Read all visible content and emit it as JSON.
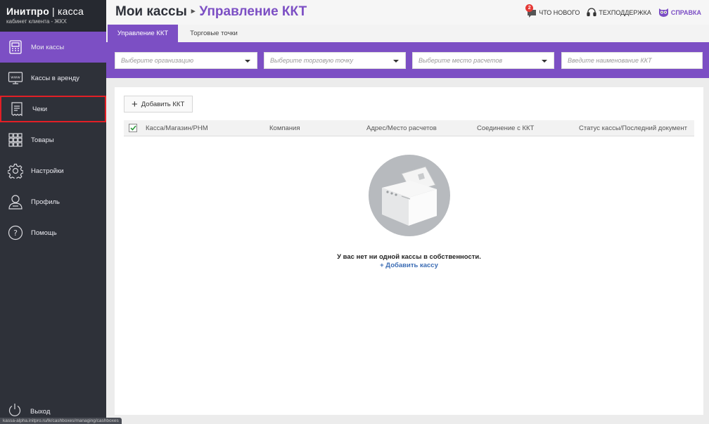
{
  "brand": {
    "title_bold": "Инитпро",
    "title_sep": "|",
    "title_light": "касса",
    "subtitle": "кабинет клиента - ЖКХ"
  },
  "sidebar": {
    "items": [
      {
        "label": "Мои кассы",
        "icon": "cash-register-icon"
      },
      {
        "label": "Кассы в аренду",
        "icon": "monitor-www-icon"
      },
      {
        "label": "Чеки",
        "icon": "receipt-icon"
      },
      {
        "label": "Товары",
        "icon": "grid-icon"
      },
      {
        "label": "Настройки",
        "icon": "gear-icon"
      },
      {
        "label": "Профиль",
        "icon": "user-icon"
      },
      {
        "label": "Помощь",
        "icon": "help-icon"
      }
    ],
    "logout": "Выход"
  },
  "status_url": "kassa-alpha.initpro.ru/lk/cashboxes/managing/cashboxes",
  "header": {
    "crumb_root": "Мои кассы",
    "crumb_current": "Управление ККТ",
    "whats_new": "ЧТО НОВОГО",
    "whats_new_badge": "2",
    "support": "ТЕХПОДДЕРЖКА",
    "help": "СПРАВКА"
  },
  "tabs": [
    "Управление ККТ",
    "Торговые точки"
  ],
  "filters": {
    "organization": "Выберите организацию",
    "trade_point": "Выберите торговую точку",
    "payment_place": "Выберите место расчетов",
    "kkt_name": "Введите наименование ККТ"
  },
  "toolbar": {
    "add_label": "Добавить ККТ"
  },
  "table": {
    "columns": [
      "Касса/Магазин/РНМ",
      "Компания",
      "Адрес/Место расчетов",
      "Соединение с ККТ",
      "Статус кассы/Последний документ"
    ]
  },
  "empty": {
    "message": "У вас нет ни одной кассы в собственности.",
    "link": "+ Добавить кассу"
  },
  "colors": {
    "accent": "#7c4fc4",
    "sidebar": "#2e3139",
    "highlight": "#e21f26",
    "link": "#3b6cb4"
  }
}
